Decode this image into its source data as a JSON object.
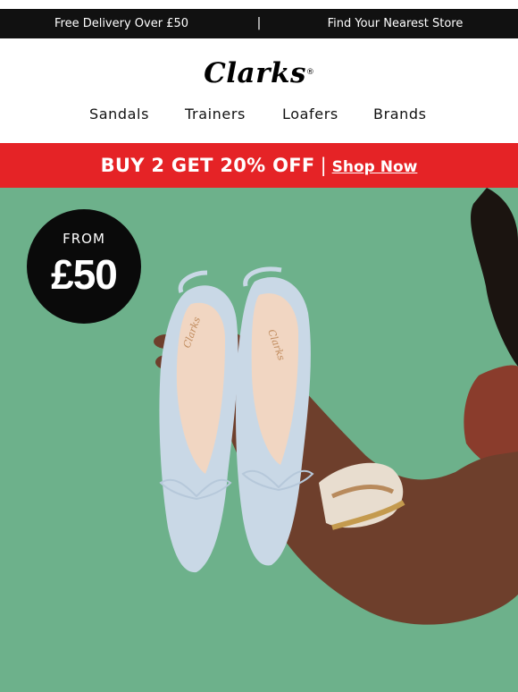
{
  "topbar": {
    "delivery": "Free Delivery Over £50",
    "separator": "|",
    "store": "Find Your Nearest Store"
  },
  "brand": {
    "logo": "Clarks",
    "registered": "®"
  },
  "nav": {
    "items": [
      "Sandals",
      "Trainers",
      "Loafers",
      "Brands"
    ]
  },
  "promo": {
    "headline": "BUY 2 GET 20% OFF",
    "separator": "|",
    "cta": "Shop Now",
    "color": "#e52326"
  },
  "hero": {
    "badge_from": "FROM",
    "badge_price": "£50",
    "shoe_brand": "Clarks",
    "background_color": "#6db18b"
  }
}
